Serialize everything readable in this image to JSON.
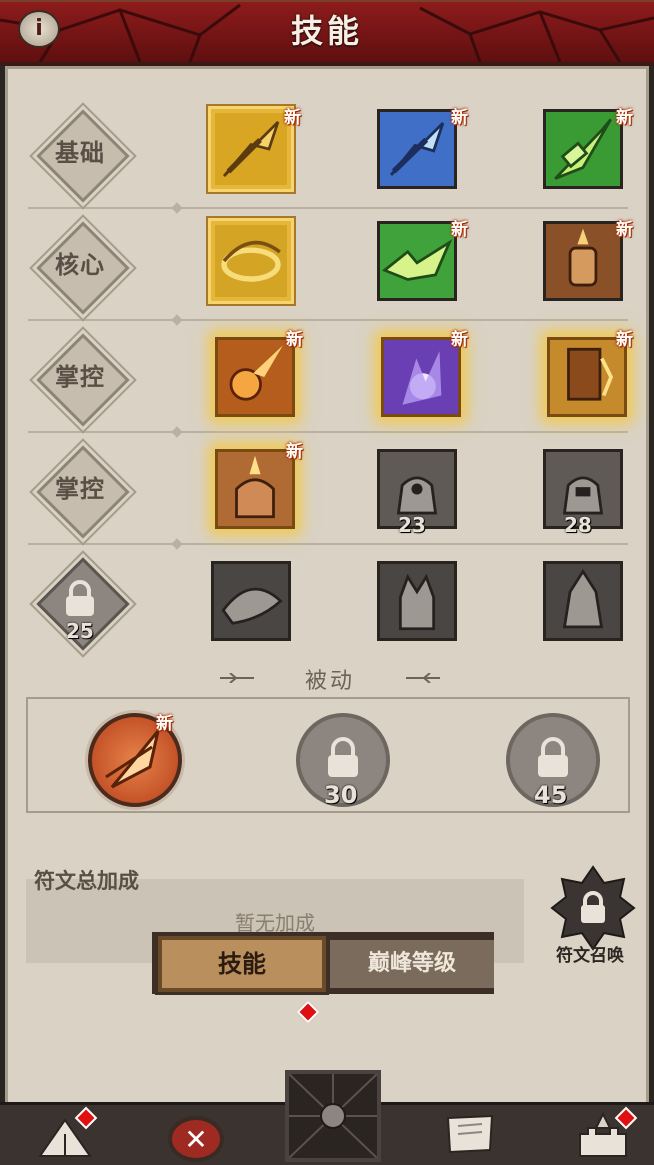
{
  "header": {
    "title": "技能",
    "info_icon": "info-icon"
  },
  "categories": [
    "基础",
    "核心",
    "掌控",
    "掌控"
  ],
  "new_label": "新",
  "skills": {
    "row1": [
      {
        "color": "gold",
        "new": true,
        "selected": true
      },
      {
        "color": "blue",
        "new": true
      },
      {
        "color": "green",
        "new": true
      }
    ],
    "row2": [
      {
        "color": "gold",
        "new": false,
        "selected": true
      },
      {
        "color": "green",
        "new": true
      },
      {
        "color": "bronze",
        "new": true
      }
    ],
    "row3": [
      {
        "color": "orange",
        "new": true,
        "glow": true
      },
      {
        "color": "purple",
        "new": true,
        "glow": true
      },
      {
        "color": "gold",
        "new": true,
        "glow": true
      }
    ],
    "row4": [
      {
        "color": "bronze",
        "new": true,
        "glow": true
      },
      {
        "color": "gray",
        "locked_level": "23"
      },
      {
        "color": "gray",
        "locked_level": "28"
      }
    ],
    "row5_lock_level": "25"
  },
  "passive": {
    "title": "被动",
    "lock_levels": [
      "30",
      "45"
    ]
  },
  "rune": {
    "label": "符文总加成",
    "empty_text": "暂无加成",
    "summon_label": "符文召唤"
  },
  "tabs": {
    "skill": "技能",
    "peak": "巅峰等级"
  },
  "colors": {
    "header_red": "#8f1c1c",
    "panel": "#d9d2c5",
    "gold_border": "#e7b73b",
    "new_badge": "#c23a00"
  }
}
